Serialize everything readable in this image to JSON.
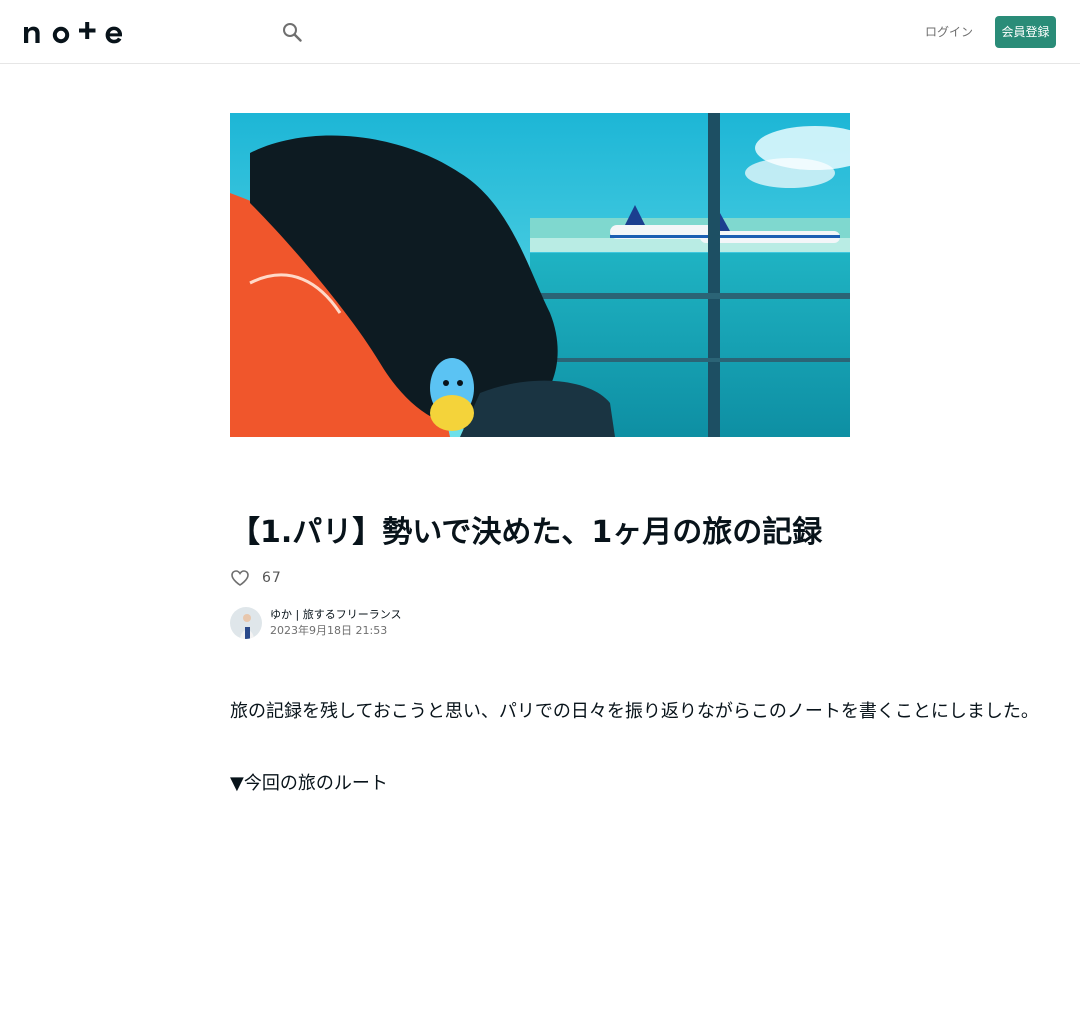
{
  "header": {
    "logo_text": "note",
    "login_label": "ログイン",
    "signup_label": "会員登録",
    "accent_color": "#2a8c78"
  },
  "article": {
    "title": "【1.パリ】勢いで決めた、1ヶ月の旅の記録",
    "like_count": "67",
    "author_name": "ゆか | 旅するフリーランス",
    "post_date": "2023年9月18日 21:53",
    "paragraphs": [
      "旅の記録を残しておこうと思い、パリでの日々を振り返りながらこのノートを書くことにしました。",
      "▼今回の旅のルート"
    ]
  },
  "icons": {
    "search": "search-icon",
    "like": "heart-icon"
  }
}
